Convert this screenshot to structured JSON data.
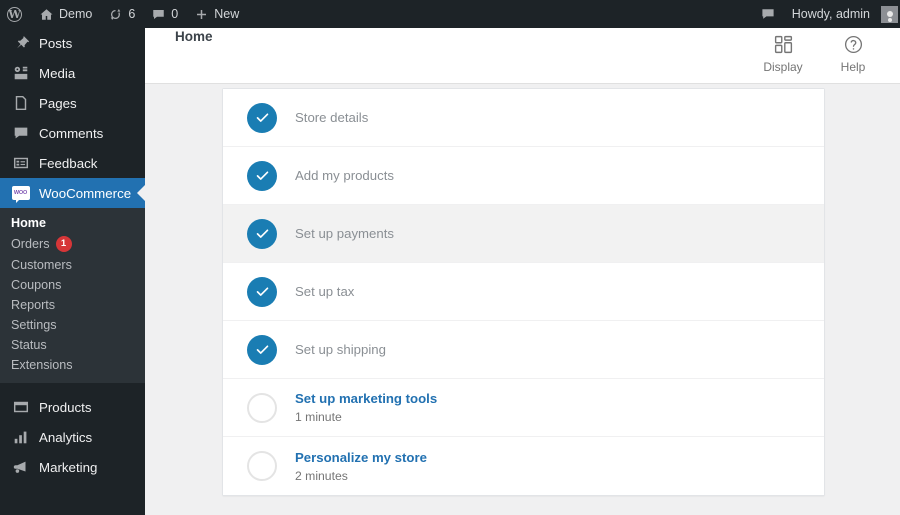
{
  "adminbar": {
    "logo_icon": "wordpress-logo-icon",
    "site_icon": "home-icon",
    "site_name": "Demo",
    "updates_icon": "updates-icon",
    "updates_count": "6",
    "comments_icon": "comment-bubble-icon",
    "comments_count": "0",
    "new_icon": "plus-icon",
    "new_label": "New",
    "feedback_icon": "feedback-bubble-icon",
    "howdy": "Howdy, admin",
    "avatar": "user-avatar"
  },
  "sidebar": {
    "items": [
      {
        "label": "Posts",
        "icon": "pin-icon"
      },
      {
        "label": "Media",
        "icon": "media-icon"
      },
      {
        "label": "Pages",
        "icon": "pages-icon"
      },
      {
        "label": "Comments",
        "icon": "comment-bubble-icon"
      },
      {
        "label": "Feedback",
        "icon": "feedback-icon"
      },
      {
        "label": "WooCommerce",
        "icon": "woocommerce-icon"
      },
      {
        "label": "Products",
        "icon": "products-icon"
      },
      {
        "label": "Analytics",
        "icon": "analytics-icon"
      },
      {
        "label": "Marketing",
        "icon": "megaphone-icon"
      }
    ],
    "submenu": [
      {
        "label": "Home",
        "badge": ""
      },
      {
        "label": "Orders",
        "badge": "1"
      },
      {
        "label": "Customers",
        "badge": ""
      },
      {
        "label": "Coupons",
        "badge": ""
      },
      {
        "label": "Reports",
        "badge": ""
      },
      {
        "label": "Settings",
        "badge": ""
      },
      {
        "label": "Status",
        "badge": ""
      },
      {
        "label": "Extensions",
        "badge": ""
      }
    ],
    "active_top": "WooCommerce",
    "active_sub": "Home",
    "highlight_color": "#2271b1",
    "badge_color": "#d63638"
  },
  "header": {
    "breadcrumb": "Home",
    "display_label": "Display",
    "display_icon": "layout-grid-icon",
    "help_label": "Help",
    "help_icon": "question-circle-icon"
  },
  "checklist": {
    "accent_color": "#1a7db3",
    "tasks": [
      {
        "title": "Store details",
        "time": "",
        "done": true,
        "hover": false
      },
      {
        "title": "Add my products",
        "time": "",
        "done": true,
        "hover": false
      },
      {
        "title": "Set up payments",
        "time": "",
        "done": true,
        "hover": true
      },
      {
        "title": "Set up tax",
        "time": "",
        "done": true,
        "hover": false
      },
      {
        "title": "Set up shipping",
        "time": "",
        "done": true,
        "hover": false
      },
      {
        "title": "Set up marketing tools",
        "time": "1 minute",
        "done": false,
        "hover": false
      },
      {
        "title": "Personalize my store",
        "time": "2 minutes",
        "done": false,
        "hover": false
      }
    ]
  }
}
